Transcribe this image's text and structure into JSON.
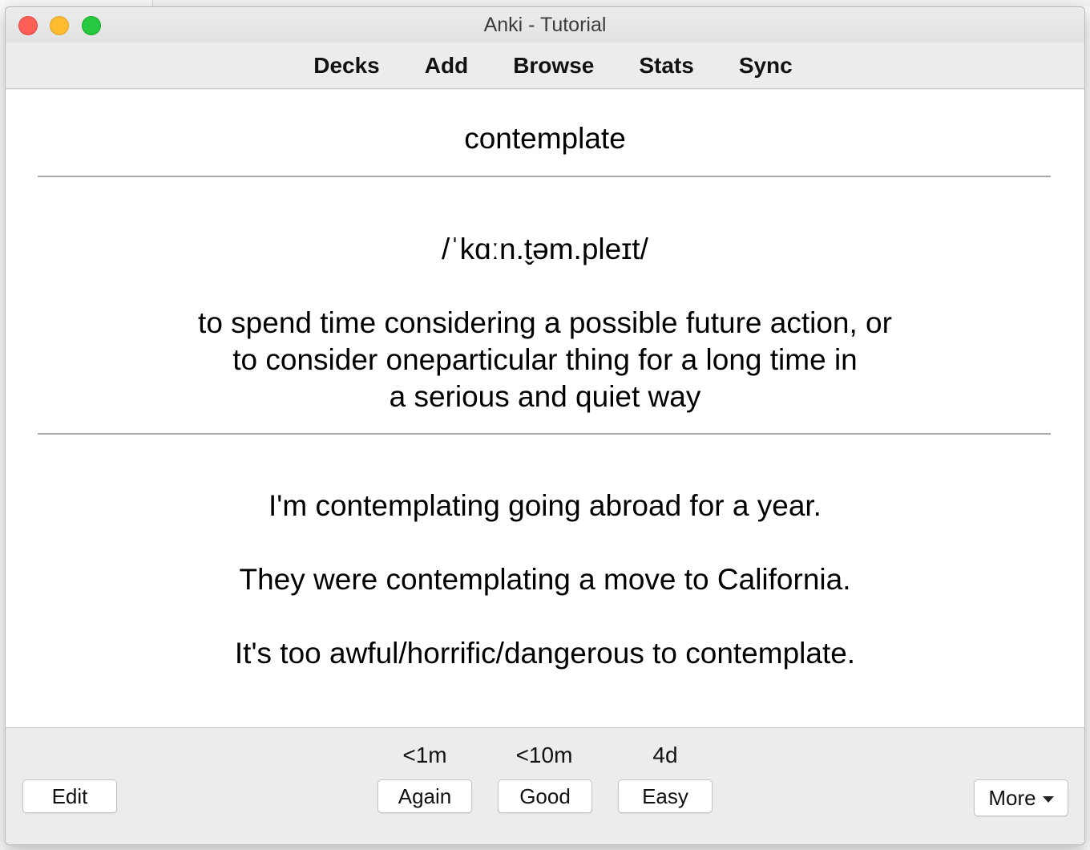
{
  "window": {
    "title": "Anki - Tutorial"
  },
  "toolbar": {
    "items": [
      {
        "label": "Decks"
      },
      {
        "label": "Add"
      },
      {
        "label": "Browse"
      },
      {
        "label": "Stats"
      },
      {
        "label": "Sync"
      }
    ]
  },
  "card": {
    "front": "contemplate",
    "pronunciation": "/ˈkɑːn.t̬əm.pleɪt/",
    "definition_lines": [
      "to spend time considering a possible future action, or",
      "to consider oneparticular thing for a long time in",
      "a serious and quiet way"
    ],
    "examples": [
      "I'm contemplating going abroad for a year.",
      "They were contemplating a move to California.",
      "It's too awful/horrific/dangerous to contemplate."
    ]
  },
  "answer_bar": {
    "edit_label": "Edit",
    "more_label": "More",
    "buttons": [
      {
        "label": "Again",
        "interval": "<1m"
      },
      {
        "label": "Good",
        "interval": "<10m"
      },
      {
        "label": "Easy",
        "interval": "4d"
      }
    ]
  },
  "colors": {
    "close": "#fd5f57",
    "minimize": "#fdbc2e",
    "maximize": "#27c840"
  }
}
